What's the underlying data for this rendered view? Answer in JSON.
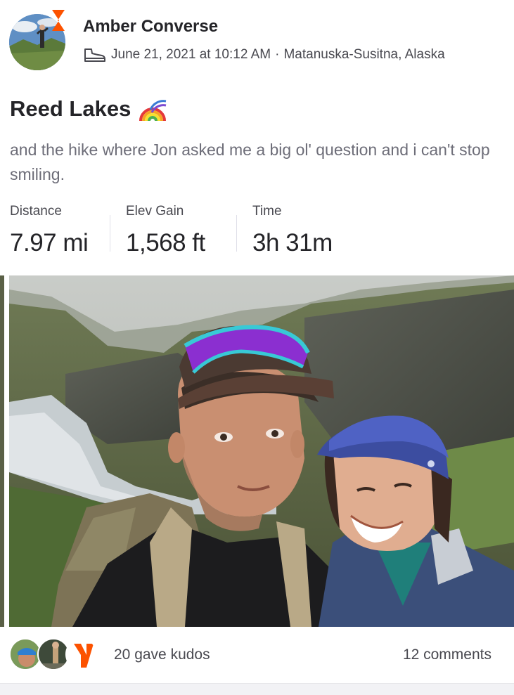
{
  "header": {
    "athlete_name": "Amber Converse",
    "activity_type_icon": "shoe-icon",
    "date": "June 21, 2021 at 10:12 AM",
    "separator": "·",
    "location": "Matanuska-Susitna, Alaska",
    "badge_icon": "strava-subscriber-badge-icon",
    "brand_color": "#fc5200"
  },
  "activity": {
    "title": "Reed Lakes",
    "title_emoji_icon": "rainbow-icon",
    "description": "and the hike where Jon asked me a big ol' question and i can't stop smiling."
  },
  "stats": [
    {
      "label": "Distance",
      "value": "7.97 mi"
    },
    {
      "label": "Elev Gain",
      "value": "1,568 ft"
    },
    {
      "label": "Time",
      "value": "3h 31m"
    }
  ],
  "footer": {
    "kudos_text": "20 gave kudos",
    "comments_text": "12 comments"
  }
}
